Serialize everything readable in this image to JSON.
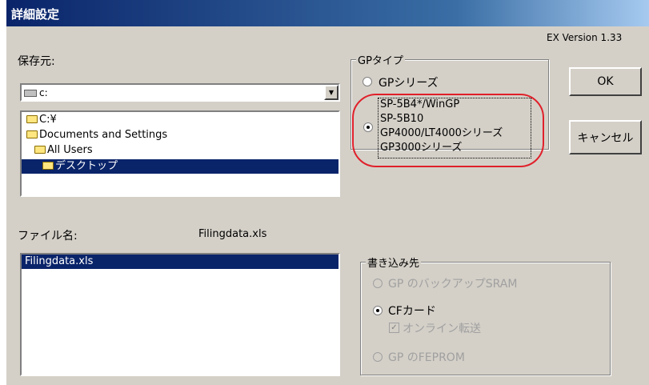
{
  "window": {
    "title": "詳細設定",
    "version": "EX Version 1.33"
  },
  "source": {
    "label": "保存元:",
    "drive_value": "c:",
    "tree": [
      {
        "label": "C:¥",
        "indent": 0,
        "selected": false
      },
      {
        "label": "Documents and Settings",
        "indent": 1,
        "selected": false
      },
      {
        "label": "All Users",
        "indent": 2,
        "selected": false
      },
      {
        "label": "デスクトップ",
        "indent": 3,
        "selected": true
      }
    ]
  },
  "file": {
    "label": "ファイル名:",
    "value": "Filingdata.xls",
    "list": [
      "Filingdata.xls"
    ]
  },
  "gp_type": {
    "legend": "GPタイプ",
    "option1": "GPシリーズ",
    "option2_lines": [
      "SP-5B4*/WinGP",
      "SP-5B10",
      "GP4000/LT4000シリーズ",
      "GP3000シリーズ"
    ],
    "selected": "option2"
  },
  "buttons": {
    "ok": "OK",
    "cancel": "キャンセル"
  },
  "write_dest": {
    "legend": "書き込み先",
    "opt_backup": "GP のバックアップSRAM",
    "opt_cf": "CFカード",
    "opt_online": "オンライン転送",
    "opt_feprom": "GP のFEPROM",
    "selected": "cf",
    "online_checked": true
  },
  "colors": {
    "title_bar": "#0a246a",
    "selection": "#0a246a",
    "annotation": "#e0202a",
    "face": "#d4d0c8"
  }
}
